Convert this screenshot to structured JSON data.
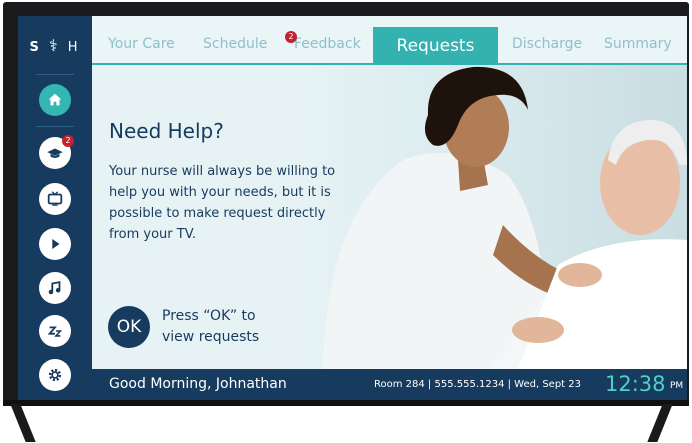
{
  "brand": {
    "left": "S",
    "mid": "⚕",
    "right": "H"
  },
  "sidebar": {
    "items": [
      {
        "name": "home",
        "icon": "home-icon"
      },
      {
        "name": "education",
        "icon": "graduation-cap-icon",
        "badge": "2"
      },
      {
        "name": "tv",
        "icon": "tv-icon"
      },
      {
        "name": "video",
        "icon": "play-icon"
      },
      {
        "name": "music",
        "icon": "music-note-icon"
      },
      {
        "name": "sleep",
        "icon": "sleep-zzz-icon"
      },
      {
        "name": "settings",
        "icon": "gear-icon"
      }
    ]
  },
  "tabs": [
    {
      "label": "Your Care"
    },
    {
      "label": "Schedule"
    },
    {
      "label": "Feedback",
      "badge": "2"
    },
    {
      "label": "Requests",
      "active": true
    },
    {
      "label": "Discharge"
    },
    {
      "label": "Summary"
    }
  ],
  "main": {
    "heading": "Need Help?",
    "body": "Your nurse will always be willing to help you with your needs, but it is possible to make request directly from your TV.",
    "ok_label": "OK",
    "ok_line1": "Press “OK” to",
    "ok_line2": "view requests"
  },
  "status": {
    "greeting": "Good Morning, Johnathan",
    "room_info": "Room 284  |  555.555.1234  |  Wed, Sept 23",
    "time": "12:38",
    "ampm": "PM"
  },
  "colors": {
    "navy": "#173b5e",
    "teal": "#33b2b0",
    "badge_red": "#c4202d",
    "clock": "#4fd0c6"
  }
}
